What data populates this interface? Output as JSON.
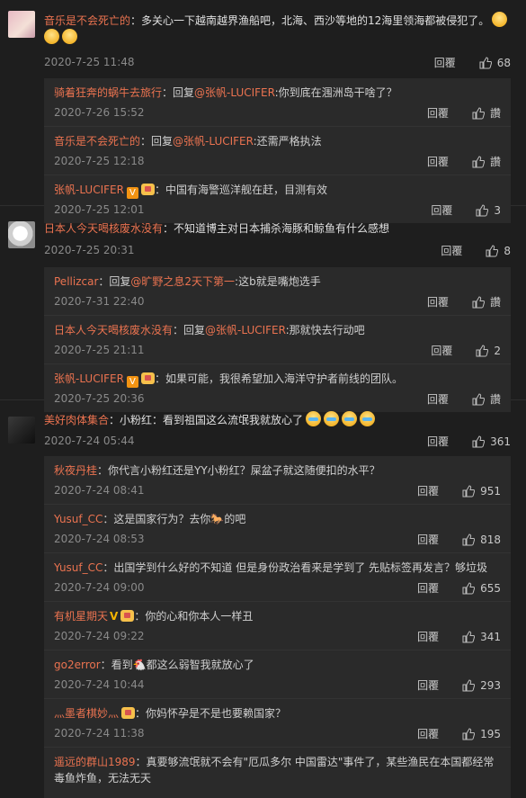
{
  "ui": {
    "reply_label": "回覆",
    "like_icon": "thumbs-up-icon"
  },
  "threads": [
    {
      "user": "音乐是不会死亡的",
      "text": "：多关心一下越南越界渔船吧，北海、西沙等地的12海里领海都被侵犯了。",
      "time": "2020-7-25 11:48",
      "likes": "68",
      "replies": [
        {
          "user": "骑着狂奔的蜗牛去旅行",
          "prefix": "：回复",
          "mention": "@张帆-LUCIFER",
          "text": ":你到底在涠洲岛干啥了？",
          "time": "2020-7-26 15:52",
          "likes": "讚"
        },
        {
          "user": "音乐是不会死亡的",
          "prefix": "：回复",
          "mention": "@张帆-LUCIFER",
          "text": ":还需严格执法",
          "time": "2020-7-25 12:18",
          "likes": "讚"
        },
        {
          "user": "张帆-LUCIFER",
          "prefix": "",
          "mention": "",
          "text": "：中国有海警巡洋舰在赶，目测有效",
          "time": "2020-7-25 12:01",
          "likes": "3"
        }
      ]
    },
    {
      "user": "日本人今天喝核废水没有",
      "text": "：不知道博主对日本捕杀海豚和鲸鱼有什么感想",
      "time": "2020-7-25 20:31",
      "likes": "8",
      "replies": [
        {
          "user": "Pellizcar",
          "prefix": "：回复",
          "mention": "@旷野之息2天下第一",
          "text": ":这b就是嘴炮选手",
          "time": "2020-7-31 22:40",
          "likes": "讚"
        },
        {
          "user": "日本人今天喝核废水没有",
          "prefix": "：回复",
          "mention": "@张帆-LUCIFER",
          "text": ":那就快去行动吧",
          "time": "2020-7-25 21:11",
          "likes": "2"
        },
        {
          "user": "张帆-LUCIFER",
          "prefix": "",
          "mention": "",
          "text": "：如果可能，我很希望加入海洋守护者前线的团队。",
          "time": "2020-7-25 20:36",
          "likes": "讚"
        }
      ]
    },
    {
      "user": "美好肉体集合",
      "text": "：小粉红：看到祖国这么流氓我就放心了",
      "time": "2020-7-24 05:44",
      "likes": "361",
      "replies": [
        {
          "user": "秋夜丹桂",
          "prefix": "",
          "mention": "",
          "text": "：你代言小粉红还是YY小粉红？屎盆子就这随便扣的水平？",
          "time": "2020-7-24 08:41",
          "likes": "951"
        },
        {
          "user": "Yusuf_CC",
          "prefix": "",
          "mention": "",
          "text": "：这是国家行为？去你🐎的吧",
          "time": "2020-7-24 08:53",
          "likes": "818"
        },
        {
          "user": "Yusuf_CC",
          "prefix": "",
          "mention": "",
          "text": "：出国学到什么好的不知道 但是身份政治看来是学到了 先贴标签再发言？够垃圾",
          "time": "2020-7-24 09:00",
          "likes": "655"
        },
        {
          "user": "有机星期天",
          "prefix": "",
          "mention": "",
          "text": "：你的心和你本人一样丑",
          "time": "2020-7-24 09:22",
          "likes": "341"
        },
        {
          "user": "go2error",
          "prefix": "",
          "mention": "",
          "text": "：看到🐔都这么弱智我就放心了",
          "time": "2020-7-24 10:44",
          "likes": "293"
        },
        {
          "user": "灬墨者棋妙灬",
          "prefix": "",
          "mention": "",
          "text": "：你妈怀孕是不是也要赖国家？",
          "time": "2020-7-24 11:38",
          "likes": "195"
        },
        {
          "user": "遥远的群山1989",
          "prefix": "",
          "mention": "",
          "text": "：真要够流氓就不会有\"厄瓜多尔 中国雷达\"事件了，某些渔民在本国都经常毒鱼炸鱼，无法无天",
          "time": "",
          "likes": ""
        }
      ]
    }
  ]
}
